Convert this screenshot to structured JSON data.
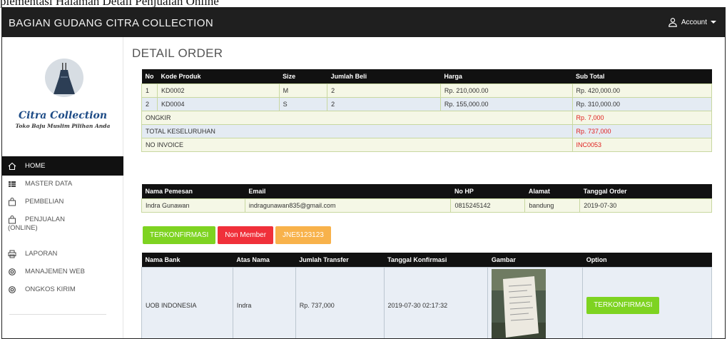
{
  "caption": "plementasi Halaman Detail Penjualan Online",
  "topbar": {
    "brand": "BAGIAN GUDANG CITRA COLLECTION",
    "account": "Account"
  },
  "logo": {
    "title": "Citra Collection",
    "subtitle": "Toko Baju Muslim Pilihan Anda"
  },
  "sidebar": {
    "items": [
      {
        "label": "HOME",
        "icon": "home-icon"
      },
      {
        "label": "MASTER DATA",
        "icon": "grid-icon"
      },
      {
        "label": "PEMBELIAN",
        "icon": "bag-icon"
      },
      {
        "label": "PENJUALAN (ONLINE)",
        "label_line1": "PENJUALAN",
        "label_line2": "(ONLINE)",
        "icon": "bag-icon"
      },
      {
        "label": "LAPORAN",
        "icon": "print-icon"
      },
      {
        "label": "MANAJEMEN WEB",
        "icon": "settings-icon"
      },
      {
        "label": "ONGKOS KIRIM",
        "icon": "settings-icon"
      }
    ]
  },
  "page": {
    "title": "DETAIL ORDER"
  },
  "order_table": {
    "headers": [
      "No",
      "Kode Produk",
      "Size",
      "Jumlah Beli",
      "Harga",
      "Sub Total"
    ],
    "rows": [
      [
        "1",
        "KD0002",
        "M",
        "2",
        "Rp. 210,000.00",
        "Rp. 420,000.00"
      ],
      [
        "2",
        "KD0004",
        "S",
        "2",
        "Rp. 155,000.00",
        "Rp. 310,000.00"
      ]
    ],
    "ongkir_label": "ONGKIR",
    "ongkir_value": "Rp. 7,000",
    "total_label": "TOTAL KESELURUHAN",
    "total_value": "Rp. 737,000",
    "invoice_label": "NO INVOICE",
    "invoice_value": "INC0053"
  },
  "customer_table": {
    "headers": [
      "Nama Pemesan",
      "Email",
      "No HP",
      "Alamat",
      "Tanggal Order"
    ],
    "row": [
      "Indra Gunawan",
      "indragunawan835@gmail.com",
      "0815245142",
      "bandung",
      "2019-07-30"
    ]
  },
  "badges": {
    "status": "TERKONFIRMASI",
    "member": "Non Member",
    "resi": "JNE5123123"
  },
  "payment_table": {
    "headers": [
      "Nama Bank",
      "Atas Nama",
      "Jumlah Transfer",
      "Tanggal Konfirmasi",
      "Gambar",
      "Option"
    ],
    "row": [
      "UOB INDONESIA",
      "Indra",
      "Rp. 737,000",
      "2019-07-30 02:17:32"
    ],
    "option_button": "TERKONFIRMASI"
  },
  "colors": {
    "topbar": "#1f1f1f",
    "green": "#7ed321",
    "red": "#f0303a",
    "orange": "#f8b24b",
    "accent_red_text": "#e0201f"
  }
}
